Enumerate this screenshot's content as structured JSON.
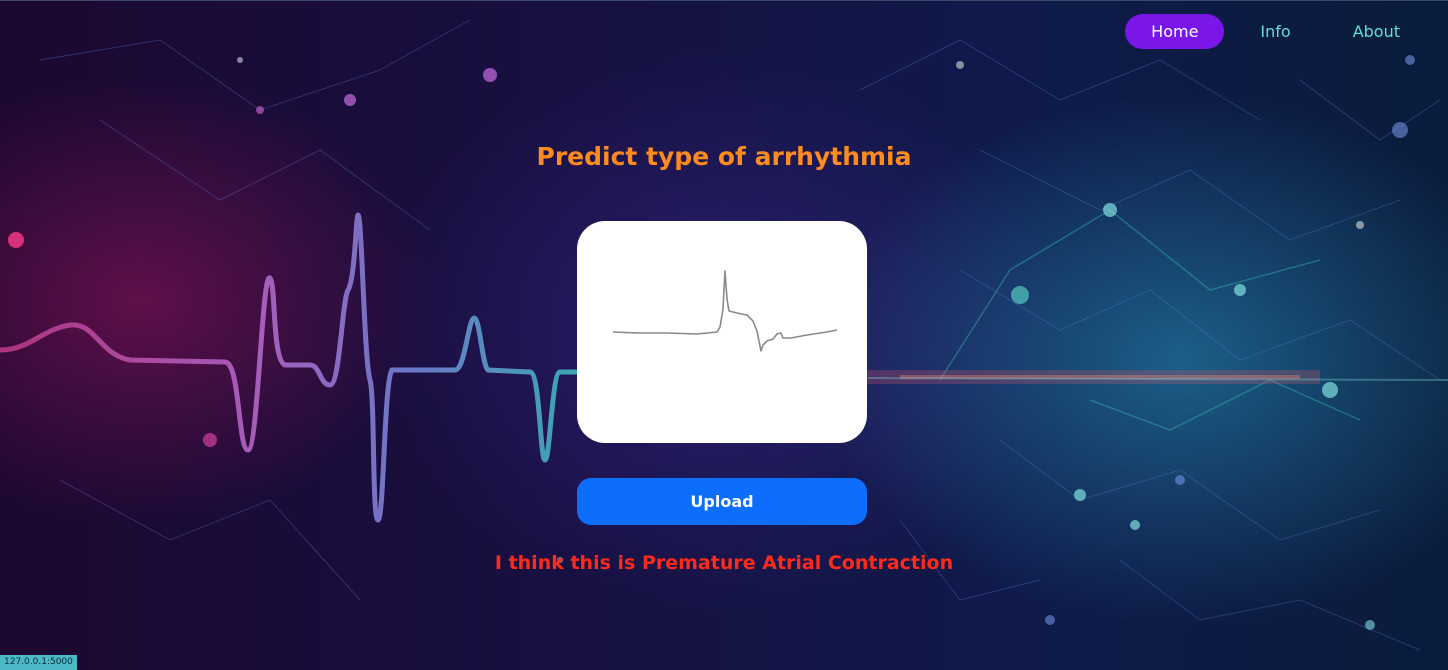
{
  "nav": {
    "items": [
      {
        "label": "Home",
        "active": true
      },
      {
        "label": "Info",
        "active": false
      },
      {
        "label": "About",
        "active": false
      }
    ]
  },
  "main": {
    "title": "Predict type of arrhythmia",
    "upload_label": "Upload",
    "result_text": "I think this is Premature Atrial Contraction"
  },
  "status_bar": {
    "url": "127.0.0.1:5000"
  },
  "colors": {
    "title": "#ff8a1e",
    "nav_active_bg": "#7a16e8",
    "nav_link": "#5fe0d4",
    "upload_bg": "#0d6efd",
    "result": "#ff2a1a"
  }
}
